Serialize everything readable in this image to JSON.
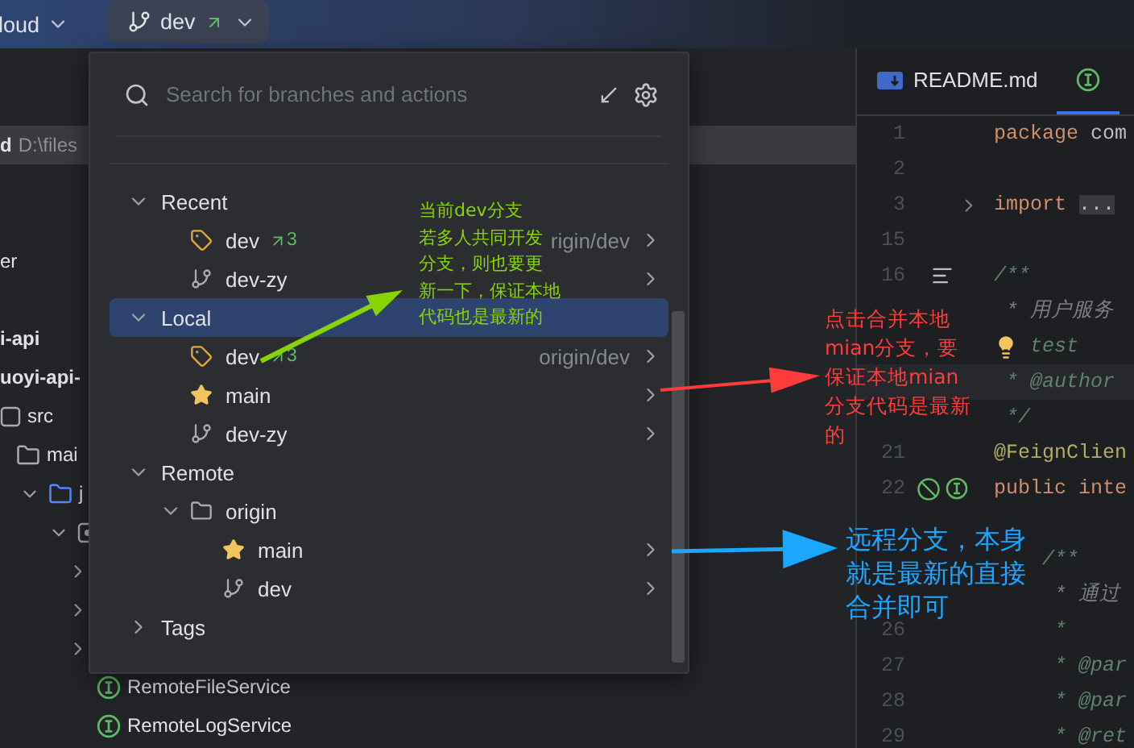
{
  "top_bar": {
    "project": "loud",
    "branch": {
      "name": "dev"
    }
  },
  "project_tree": [
    {
      "kind": "root",
      "name": "d",
      "path": "D:\\files",
      "selected": true
    },
    {
      "kind": "plain",
      "name": "er",
      "selected": false
    },
    {
      "kind": "module",
      "name": "i-api",
      "selected": false
    },
    {
      "kind": "module",
      "name": "uoyi-api-",
      "selected": false,
      "children": [
        {
          "kind": "source",
          "name": "src",
          "selected": false,
          "children": [
            {
              "kind": "folder",
              "name": "mai",
              "selected": false,
              "children": [
                {
                  "kind": "java-folder",
                  "name": "j",
                  "expanded": true,
                  "selected": false,
                  "children": [
                    {
                      "kind": "package",
                      "expanded": true,
                      "selected": false,
                      "children": [
                        {
                          "kind": "plain",
                          "expanded": false,
                          "selected": false
                        },
                        {
                          "kind": "plain",
                          "expanded": false,
                          "selected": false
                        },
                        {
                          "kind": "plain",
                          "expanded": false,
                          "selected": false
                        },
                        {
                          "kind": "interface",
                          "name": "RemoteFileService",
                          "selected": false
                        },
                        {
                          "kind": "interface",
                          "name": "RemoteLogService",
                          "selected": false
                        }
                      ]
                    }
                  ]
                }
              ]
            }
          ]
        }
      ]
    }
  ],
  "branches_popup": {
    "search": {
      "placeholder": "Search for branches and actions"
    },
    "tree": [
      {
        "label": "Recent",
        "expanded": true,
        "selected": false,
        "children": [
          {
            "kind": "tag",
            "label": "dev",
            "ahead": "3",
            "tracking": "rigin/dev",
            "selected": false
          },
          {
            "kind": "branch",
            "label": "dev-zy",
            "selected": false
          }
        ]
      },
      {
        "label": "Local",
        "expanded": true,
        "selected": true,
        "children": [
          {
            "kind": "tag",
            "label": "dev",
            "ahead": "3",
            "tracking": "origin/dev",
            "selected": false
          },
          {
            "kind": "star",
            "label": "main",
            "selected": false
          },
          {
            "kind": "branch",
            "label": "dev-zy",
            "selected": false
          }
        ]
      },
      {
        "label": "Remote",
        "expanded": true,
        "selected": false,
        "children": [
          {
            "kind": "folder",
            "label": "origin",
            "expanded": true,
            "selected": false,
            "children": [
              {
                "kind": "star",
                "label": "main",
                "selected": false
              },
              {
                "kind": "branch",
                "label": "dev",
                "selected": false
              }
            ]
          }
        ]
      },
      {
        "label": "Tags",
        "expanded": false,
        "selected": false
      }
    ]
  },
  "editor": {
    "tabs": [
      {
        "kind": "markdown",
        "label": "README.md",
        "selected": false
      },
      {
        "kind": "interface",
        "selected": true
      }
    ],
    "lines": [
      {
        "kind": "plain",
        "number": "1",
        "current": false,
        "code": [
          {
            "text": "package ",
            "kind": "keyword"
          },
          {
            "text": "com",
            "kind": "plain"
          }
        ]
      },
      {
        "kind": "plain",
        "number": "2",
        "current": false
      },
      {
        "kind": "fold",
        "number": "3",
        "current": false,
        "code": [
          {
            "text": "import ",
            "kind": "keyword"
          },
          {
            "text": "...",
            "kind": "folded"
          }
        ]
      },
      {
        "kind": "plain",
        "number": "15",
        "current": false
      },
      {
        "kind": "list",
        "number": "16",
        "current": false,
        "code": [
          {
            "text": "/**",
            "kind": "doc"
          }
        ]
      },
      {
        "kind": "plain",
        "current": false,
        "code": [
          {
            "text": " * 用户服务",
            "kind": "comment"
          }
        ]
      },
      {
        "kind": "bulb",
        "current": false,
        "code": [
          {
            "text": " test",
            "kind": "doc"
          }
        ]
      },
      {
        "kind": "plain",
        "current": true,
        "code": [
          {
            "text": " * @author",
            "kind": "doc"
          }
        ]
      },
      {
        "kind": "plain",
        "current": false,
        "code": [
          {
            "text": " */",
            "kind": "doc"
          }
        ]
      },
      {
        "kind": "plain",
        "number": "21",
        "current": false,
        "code": [
          {
            "text": "@FeignClien",
            "kind": "annotation"
          }
        ]
      },
      {
        "kind": "implemented",
        "number": "22",
        "current": false,
        "code": [
          {
            "text": "public inte",
            "kind": "keyword"
          }
        ]
      },
      {
        "kind": "plain",
        "current": false
      },
      {
        "kind": "plain",
        "current": false,
        "code": [
          {
            "text": "    /**",
            "kind": "doc"
          }
        ]
      },
      {
        "kind": "plain",
        "current": false,
        "code": [
          {
            "text": "     * 通过",
            "kind": "comment"
          }
        ]
      },
      {
        "kind": "plain",
        "number": "26",
        "current": false,
        "code": [
          {
            "text": "     *",
            "kind": "doc"
          }
        ]
      },
      {
        "kind": "plain",
        "number": "27",
        "current": false,
        "code": [
          {
            "text": "     * @par",
            "kind": "doc"
          }
        ]
      },
      {
        "kind": "plain",
        "number": "28",
        "current": false,
        "code": [
          {
            "text": "     * @par",
            "kind": "doc"
          }
        ]
      },
      {
        "kind": "plain",
        "number": "29",
        "current": false,
        "code": [
          {
            "text": "     * @ret",
            "kind": "doc"
          }
        ]
      }
    ]
  },
  "annotations": [
    {
      "color": "#86d500",
      "lines": [
        "当前dev分支",
        "若多人共同开发",
        "分支，则也要更",
        "新一下，保证本地",
        "代码也是最新的"
      ]
    },
    {
      "color": "#ff3c3c",
      "lines": [
        "点击合并本地",
        "mian分支，要",
        "保证本地mian",
        "分支代码是最新",
        "的"
      ]
    },
    {
      "color": "#1ba6ff",
      "lines": [
        "远程分支，本身",
        "就是最新的直接",
        "合并即可"
      ]
    }
  ]
}
